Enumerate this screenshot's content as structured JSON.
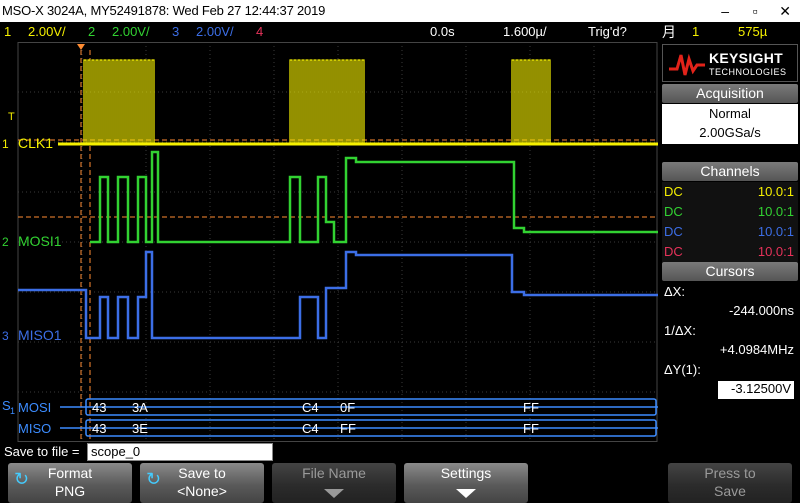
{
  "title": "MSO-X 3024A, MY52491878: Wed Feb 27 12:44:37 2019",
  "window_buttons": [
    "–",
    "▫",
    "✕"
  ],
  "status": {
    "ch1": "1",
    "ch1_scale": "2.00V/",
    "ch2": "2",
    "ch2_scale": "2.00V/",
    "ch3": "3",
    "ch3_scale": "2.00V/",
    "ch4": "4",
    "delay": "0.0s",
    "timebase": "1.600µ/",
    "trig_status": "Trig'd?",
    "trig_icon": "trigger-edge-icon",
    "trig_src": "1",
    "trig_level": "575µ"
  },
  "colors": {
    "ch1": "#f5f000",
    "ch2": "#32d232",
    "ch3": "#3c6ee6",
    "ch4": "#e6325a",
    "bus": "#3c8cff",
    "cursor": "#ff8c32"
  },
  "traces": {
    "clk_label": "CLK1",
    "mosi_label": "MOSI1",
    "miso_label": "MISO1",
    "trig_marker": "T",
    "ch1_marker": "1",
    "ch2_marker": "2",
    "ch3_marker": "3"
  },
  "bus": {
    "marker": "S",
    "marker_sub": "1",
    "mosi_label": "MOSI",
    "miso_label": "MISO",
    "mosi_values": [
      "43",
      "3A",
      "C4",
      "0F",
      "FF"
    ],
    "miso_values": [
      "43",
      "3E",
      "C4",
      "FF",
      "FF"
    ]
  },
  "panel": {
    "brand": "KEYSIGHT",
    "sub": "TECHNOLOGIES",
    "acq_head": "Acquisition",
    "acq_mode": "Normal",
    "acq_rate": "2.00GSa/s",
    "channels_head": "Channels",
    "channels": [
      {
        "coupling": "DC",
        "probe": "10.0:1"
      },
      {
        "coupling": "DC",
        "probe": "10.0:1"
      },
      {
        "coupling": "DC",
        "probe": "10.0:1"
      },
      {
        "coupling": "DC",
        "probe": "10.0:1"
      }
    ],
    "cursors_head": "Cursors",
    "dx_label": "ΔX:",
    "dx_value": "-244.000ns",
    "inv_dx_label": "1/ΔX:",
    "inv_dx_value": "+4.0984MHz",
    "dy_label": "ΔY(1):",
    "dy_value": "-3.12500V"
  },
  "save": {
    "label": "Save to file =",
    "filename": "scope_0"
  },
  "softkeys": [
    {
      "l1": "Format",
      "l2": "PNG"
    },
    {
      "l1": "Save to",
      "l2": "<None>"
    },
    {
      "l1": "File Name",
      "l2": ""
    },
    {
      "l1": "Settings",
      "l2": ""
    },
    {
      "l1": "Press to",
      "l2": "Save"
    }
  ]
}
